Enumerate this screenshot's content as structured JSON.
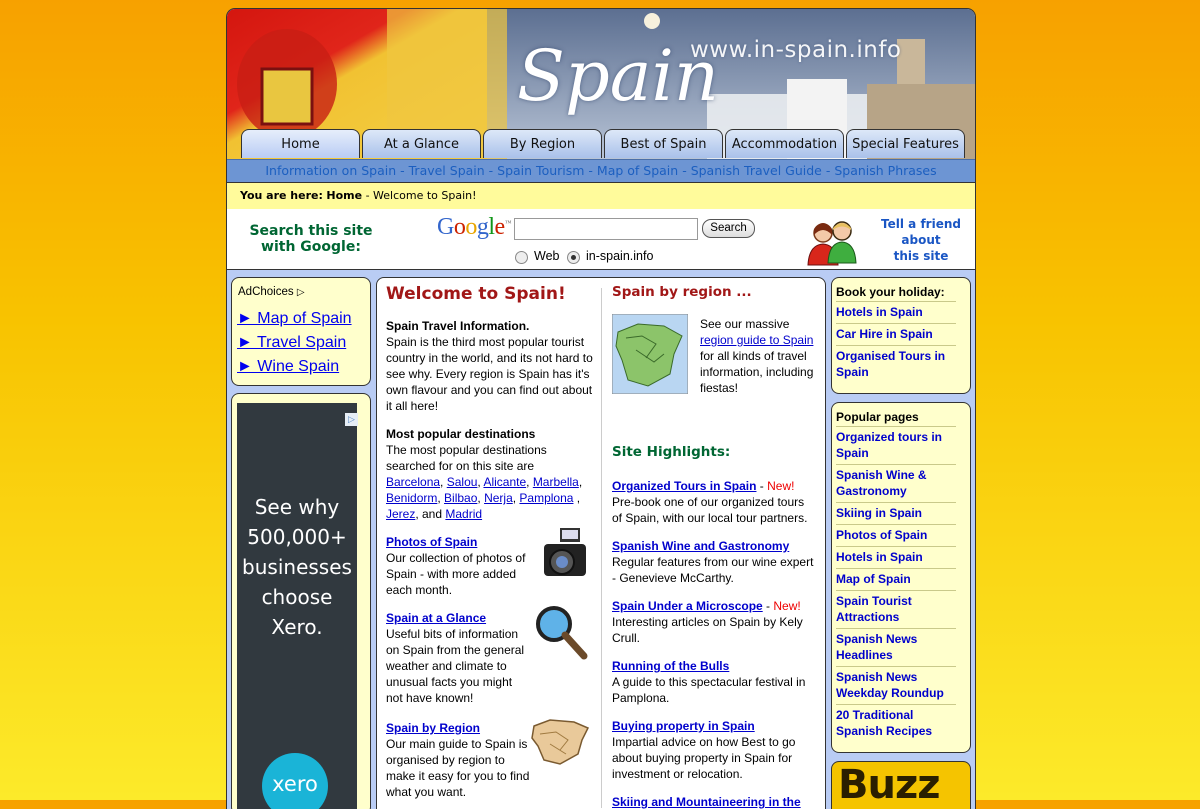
{
  "banner": {
    "url_text": "www.in-spain.info",
    "logo_text": "Spain"
  },
  "tabs": [
    {
      "label": "Home"
    },
    {
      "label": "At a Glance"
    },
    {
      "label": "By Region"
    },
    {
      "label": "Best of Spain"
    },
    {
      "label": "Accommodation"
    },
    {
      "label": "Special Features"
    }
  ],
  "subnav": {
    "items": [
      "Information on Spain",
      "Travel Spain",
      "Spain Tourism",
      "Map of Spain",
      "Spanish Travel Guide",
      "Spanish Phrases"
    ],
    "separator": " - "
  },
  "breadcrumb": {
    "prefix": "You are here:",
    "home": "Home",
    "sep": " - ",
    "current": "Welcome to Spain!"
  },
  "search": {
    "label": "Search this site with Google:",
    "logo": "Google",
    "logo_tm": "™",
    "input_value": "",
    "button": "Search",
    "options": [
      {
        "label": "Web",
        "selected": false
      },
      {
        "label": "in-spain.info",
        "selected": true
      }
    ]
  },
  "tell_friend": {
    "line1": "Tell a friend",
    "line2": "about",
    "line3": "this site"
  },
  "left_ad": {
    "adchoices": "AdChoices",
    "links": [
      "► Map of Spain",
      "► Travel Spain",
      "► Wine Spain"
    ],
    "banner_text": [
      "See why",
      "500,000+",
      "businesses",
      "choose",
      "Xero."
    ],
    "banner_brand": "xero"
  },
  "main": {
    "title": "Welcome to Spain!",
    "intro_heading": "Spain Travel Information.",
    "intro_text": "Spain is the third most popular tourist country in the world, and its not hard to see why. Every region is Spain has it's own flavour and you can find out about it all here!",
    "dest_heading": "Most popular destinations",
    "dest_text": "The most popular destinations searched for on this site are",
    "destinations": [
      "Barcelona",
      "Salou",
      "Alicante",
      "Marbella",
      "Benidorm",
      "Bilbao",
      "Nerja",
      "Pamplona",
      "Jerez",
      "Madrid"
    ],
    "dest_and": ", and",
    "features": [
      {
        "title": "Photos of Spain",
        "text": "Our collection of photos of Spain - with more added each month.",
        "icon": "camera-icon"
      },
      {
        "title": "Spain at a Glance",
        "text": "Useful bits of information on Spain from the general weather and climate to unusual facts you might not have known!",
        "icon": "magnifier-icon"
      },
      {
        "title": "Spain by Region",
        "text": "Our main guide to Spain is organised by region to make it easy for you to find what you want.",
        "icon": "map-icon"
      }
    ],
    "region_title": "Spain by region ...",
    "region_text_pre": "See our massive",
    "region_link": "region guide to Spain",
    "region_text_post": "for all kinds of travel information, including fiestas!",
    "highlights_title": "Site Highlights:",
    "highlights": [
      {
        "title": "Organized Tours in Spain",
        "new": "New!",
        "text": "Pre-book one of our organized tours of Spain, with our local tour partners."
      },
      {
        "title": "Spanish Wine and Gastronomy",
        "new": "",
        "text": "Regular features from our wine expert - Genevieve McCarthy."
      },
      {
        "title": "Spain Under a Microscope",
        "new": "New!",
        "text": "Interesting articles on Spain by Kely Crull."
      },
      {
        "title": "Running of the Bulls",
        "new": "",
        "text": "A guide to this spectacular festival in Pamplona."
      },
      {
        "title": "Buying property in Spain",
        "new": "",
        "text": "Impartial advice on how Best to go about buying property in Spain for investment or relocation."
      },
      {
        "title": "Skiing and Mountaineering in the Pyrenees",
        "new": "",
        "text": ""
      }
    ]
  },
  "right_book": {
    "title": "Book your holiday:",
    "links": [
      "Hotels in Spain",
      "Car Hire in Spain",
      "Organised Tours in Spain"
    ]
  },
  "right_popular": {
    "title": "Popular pages",
    "links": [
      "Organized tours in Spain",
      "Spanish Wine & Gastronomy",
      "Skiing in Spain",
      "Photos of Spain",
      "Hotels in Spain",
      "Map of Spain",
      "Spain Tourist Attractions",
      "Spanish News Headlines",
      "Spanish News Weekday Roundup",
      "20 Traditional Spanish Recipes"
    ]
  },
  "buzz": {
    "text": "Buzz"
  },
  "colors": {
    "header_blue": "#6d95d3",
    "crumb_yellow": "#fffb9b",
    "box_yellow": "#ffffcc",
    "title_red": "#a11717",
    "green": "#006633",
    "link": "#0000cc"
  }
}
